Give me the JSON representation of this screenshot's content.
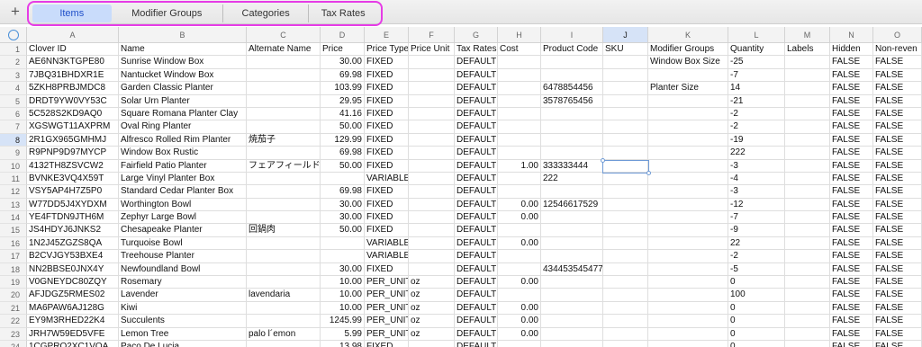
{
  "tabs": [
    {
      "label": "Items",
      "active": true
    },
    {
      "label": "Modifier Groups",
      "active": false
    },
    {
      "label": "Categories",
      "active": false
    },
    {
      "label": "Tax Rates",
      "active": false
    }
  ],
  "add_sheet_symbol": "+",
  "selected_cell": "J8",
  "columns": [
    "A",
    "B",
    "C",
    "D",
    "E",
    "F",
    "G",
    "H",
    "I",
    "J",
    "K",
    "L",
    "M",
    "N",
    "O"
  ],
  "numeric_columns": [
    3,
    7
  ],
  "rows": [
    [
      "Clover ID",
      "Name",
      "Alternate Name",
      "Price",
      "Price Type",
      "Price Unit",
      "Tax Rates",
      "Cost",
      "Product Code",
      "SKU",
      "Modifier Groups",
      "Quantity",
      "Labels",
      "Hidden",
      "Non-reven"
    ],
    [
      "AE6NN3KTGPE80",
      "Sunrise Window Box",
      "",
      "30.00",
      "FIXED",
      "",
      "DEFAULT",
      "",
      "",
      "",
      "Window Box Size",
      "-25",
      "",
      "FALSE",
      "FALSE"
    ],
    [
      "7JBQ31BHDXR1E",
      "Nantucket Window Box",
      "",
      "69.98",
      "FIXED",
      "",
      "DEFAULT",
      "",
      "",
      "",
      "",
      "-7",
      "",
      "FALSE",
      "FALSE"
    ],
    [
      "5ZKH8PRBJMDC8",
      "Garden Classic Planter",
      "",
      "103.99",
      "FIXED",
      "",
      "DEFAULT",
      "",
      "6478854456",
      "",
      "Planter Size",
      "14",
      "",
      "FALSE",
      "FALSE"
    ],
    [
      "DRDT9YW0VY53C",
      "Solar Urn Planter",
      "",
      "29.95",
      "FIXED",
      "",
      "DEFAULT",
      "",
      "3578765456",
      "",
      "",
      "-21",
      "",
      "FALSE",
      "FALSE"
    ],
    [
      "5C528S2KD9AQ0",
      "Square Romana Planter Clay",
      "",
      "41.16",
      "FIXED",
      "",
      "DEFAULT",
      "",
      "",
      "",
      "",
      "-2",
      "",
      "FALSE",
      "FALSE"
    ],
    [
      "XGSWGT11AXPRM",
      "Oval Ring Planter",
      "",
      "50.00",
      "FIXED",
      "",
      "DEFAULT",
      "",
      "",
      "",
      "",
      "-2",
      "",
      "FALSE",
      "FALSE"
    ],
    [
      "2R1GX965GMHMJ",
      "Alfresco Rolled Rim Planter",
      "焼茄子",
      "129.99",
      "FIXED",
      "",
      "DEFAULT",
      "",
      "",
      "",
      "",
      "-19",
      "",
      "FALSE",
      "FALSE"
    ],
    [
      "R9PNP9D97MYCP",
      "Window Box Rustic",
      "",
      "69.98",
      "FIXED",
      "",
      "DEFAULT",
      "",
      "",
      "",
      "",
      "222",
      "",
      "FALSE",
      "FALSE"
    ],
    [
      "4132TH8ZSVCW2",
      "Fairfield Patio Planter",
      "フェアフィールド",
      "50.00",
      "FIXED",
      "",
      "DEFAULT",
      "1.00",
      "333333444",
      "",
      "",
      "-3",
      "",
      "FALSE",
      "FALSE"
    ],
    [
      "BVNKE3VQ4X59T",
      "Large Vinyl Planter Box",
      "",
      "",
      "VARIABLE",
      "",
      "DEFAULT",
      "",
      "222",
      "",
      "",
      "-4",
      "",
      "FALSE",
      "FALSE"
    ],
    [
      "VSY5AP4H7Z5P0",
      "Standard Cedar Planter Box",
      "",
      "69.98",
      "FIXED",
      "",
      "DEFAULT",
      "",
      "",
      "",
      "",
      "-3",
      "",
      "FALSE",
      "FALSE"
    ],
    [
      "W77DD5J4XYDXM",
      "Worthington Bowl",
      "",
      "30.00",
      "FIXED",
      "",
      "DEFAULT",
      "0.00",
      "12546617529",
      "",
      "",
      "-12",
      "",
      "FALSE",
      "FALSE"
    ],
    [
      "YE4FTDN9JTH6M",
      "Zephyr Large Bowl",
      "",
      "30.00",
      "FIXED",
      "",
      "DEFAULT",
      "0.00",
      "",
      "",
      "",
      "-7",
      "",
      "FALSE",
      "FALSE"
    ],
    [
      "JS4HDYJ6JNKS2",
      "Chesapeake Planter",
      "回鍋肉",
      "50.00",
      "FIXED",
      "",
      "DEFAULT",
      "",
      "",
      "",
      "",
      "-9",
      "",
      "FALSE",
      "FALSE"
    ],
    [
      "1N2J45ZGZS8QA",
      "Turquoise Bowl",
      "",
      "",
      "VARIABLE",
      "",
      "DEFAULT",
      "0.00",
      "",
      "",
      "",
      "22",
      "",
      "FALSE",
      "FALSE"
    ],
    [
      "B2CVJGY53BXE4",
      "Treehouse Planter",
      "",
      "",
      "VARIABLE",
      "",
      "DEFAULT",
      "",
      "",
      "",
      "",
      "-2",
      "",
      "FALSE",
      "FALSE"
    ],
    [
      "NN2BBSE0JNX4Y",
      "Newfoundland Bowl",
      "",
      "30.00",
      "FIXED",
      "",
      "DEFAULT",
      "",
      "434453545477",
      "",
      "",
      "-5",
      "",
      "FALSE",
      "FALSE"
    ],
    [
      "V0GNEYDC80ZQY",
      "Rosemary",
      "",
      "10.00",
      "PER_UNIT",
      "oz",
      "DEFAULT",
      "0.00",
      "",
      "",
      "",
      "0",
      "",
      "FALSE",
      "FALSE"
    ],
    [
      "AFJDGZ5RMES02",
      "Lavender",
      "lavendaria",
      "10.00",
      "PER_UNIT",
      "oz",
      "DEFAULT",
      "",
      "",
      "",
      "",
      "100",
      "",
      "FALSE",
      "FALSE"
    ],
    [
      "MA6PAW6AJ128G",
      "Kiwi",
      "",
      "10.00",
      "PER_UNIT",
      "oz",
      "DEFAULT",
      "0.00",
      "",
      "",
      "",
      "0",
      "",
      "FALSE",
      "FALSE"
    ],
    [
      "EY9M3RHED22K4",
      "Succulents",
      "",
      "1245.99",
      "PER_UNIT",
      "oz",
      "DEFAULT",
      "0.00",
      "",
      "",
      "",
      "0",
      "",
      "FALSE",
      "FALSE"
    ],
    [
      "JRH7W59ED5VFE",
      "Lemon Tree",
      "palo l´emon",
      "5.99",
      "PER_UNIT",
      "oz",
      "DEFAULT",
      "0.00",
      "",
      "",
      "",
      "0",
      "",
      "FALSE",
      "FALSE"
    ],
    [
      "1CGPRQ2XC1VQA",
      "Paco De Lucia",
      "",
      "13.98",
      "FIXED",
      "",
      "DEFAULT",
      "",
      "",
      "",
      "",
      "0",
      "",
      "FALSE",
      "FALSE"
    ]
  ],
  "colors": {
    "tab_highlight_border": "#e63ce6",
    "active_tab_bg": "#c9dcfb",
    "selection_border": "#6e9ad6"
  }
}
